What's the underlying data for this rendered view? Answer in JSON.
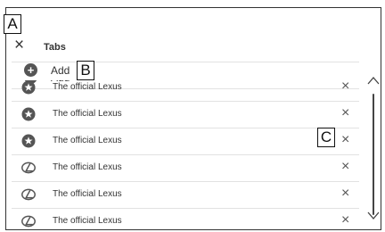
{
  "callouts": {
    "a": "A",
    "b": "B",
    "c": "C"
  },
  "header": {
    "title": "Tabs",
    "close_glyph": "×"
  },
  "add": {
    "label": "Add",
    "icon": "plus-circle-icon"
  },
  "rows": [
    {
      "label": "The official Lexus",
      "icon": "star-circle-icon",
      "remove": "×"
    },
    {
      "label": "The official Lexus",
      "icon": "star-circle-icon",
      "remove": "×"
    },
    {
      "label": "The official Lexus",
      "icon": "star-circle-icon",
      "remove": "×"
    },
    {
      "label": "The official Lexus",
      "icon": "lexus-logo-icon",
      "remove": "×"
    },
    {
      "label": "The official Lexus",
      "icon": "lexus-logo-icon",
      "remove": "×"
    },
    {
      "label": "The official Lexus",
      "icon": "lexus-logo-icon",
      "remove": "×"
    }
  ],
  "colors": {
    "border": "#333333",
    "icon": "#555555"
  }
}
